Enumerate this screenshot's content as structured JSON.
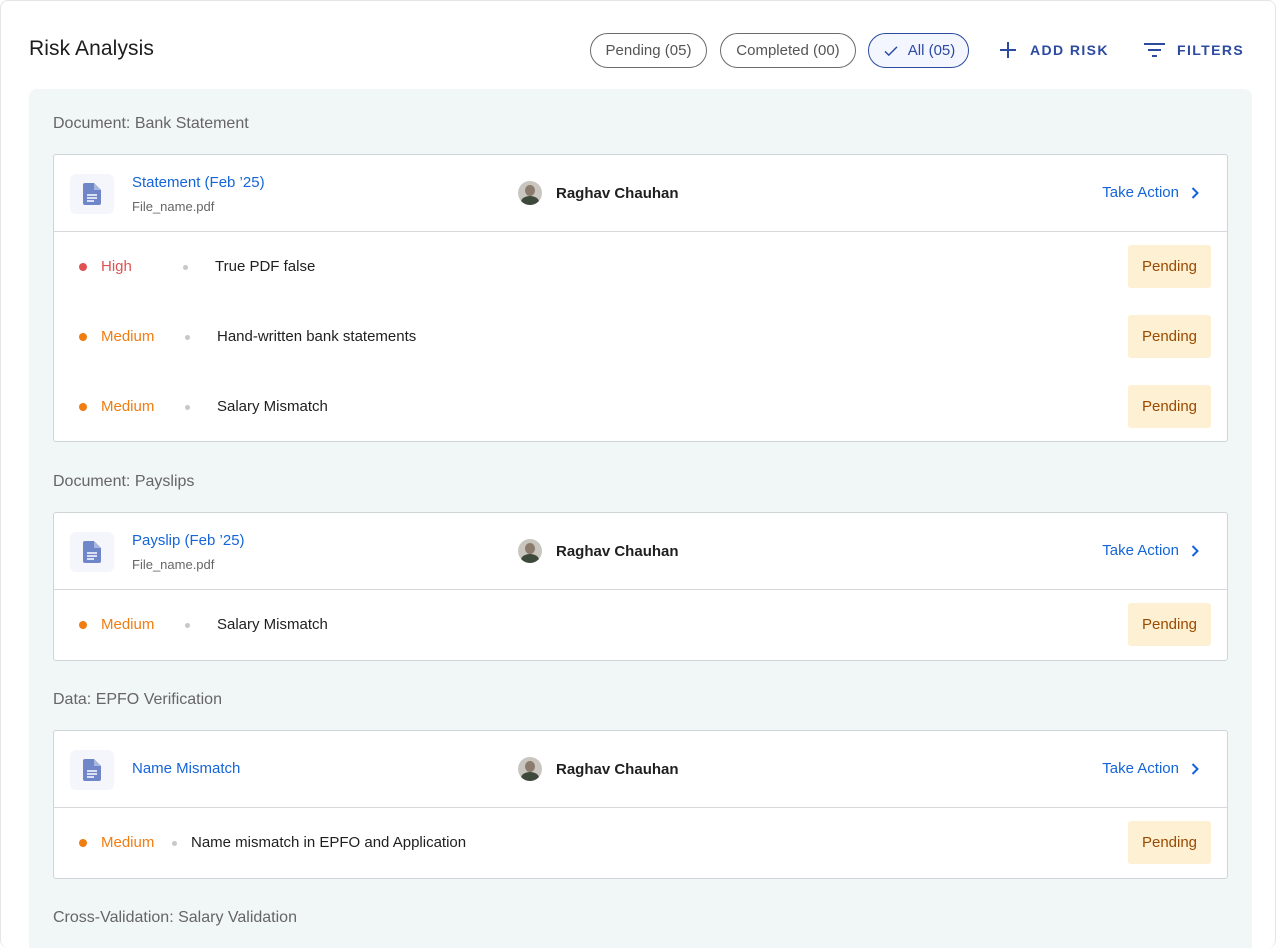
{
  "header": {
    "title": "Risk Analysis",
    "chips": [
      {
        "label": "Pending (05)"
      },
      {
        "label": "Completed (00)"
      },
      {
        "label": "All (05)"
      }
    ],
    "add_risk_label": "ADD RISK",
    "filters_label": "FILTERS"
  },
  "colors": {
    "accent": "#2b4aa0",
    "link": "#1565d8",
    "high": "#e05252",
    "medium": "#ef7d12",
    "badge_bg": "#fdf0d3",
    "badge_text": "#9a4a00"
  },
  "sections": [
    {
      "title": "Document: Bank Statement",
      "card": {
        "doc_title": "Statement (Feb ’25)",
        "file_name": "File_name.pdf",
        "owner": "Raghav Chauhan",
        "action": "Take Action",
        "risks": [
          {
            "severity": "High",
            "text": "True PDF false",
            "status": "Pending"
          },
          {
            "severity": "Medium",
            "text": "Hand-written bank statements",
            "status": "Pending"
          },
          {
            "severity": "Medium",
            "text": "Salary Mismatch",
            "status": "Pending"
          }
        ]
      }
    },
    {
      "title": "Document: Payslips",
      "card": {
        "doc_title": "Payslip (Feb ’25)",
        "file_name": "File_name.pdf",
        "owner": "Raghav Chauhan",
        "action": "Take Action",
        "risks": [
          {
            "severity": "Medium",
            "text": "Salary Mismatch",
            "status": "Pending"
          }
        ]
      }
    },
    {
      "title": "Data: EPFO Verification",
      "card": {
        "doc_title": "Name Mismatch",
        "owner": "Raghav Chauhan",
        "action": "Take Action",
        "risks": [
          {
            "severity": "Medium",
            "text": "Name mismatch in EPFO and Application",
            "status": "Pending"
          }
        ]
      }
    },
    {
      "title": "Cross-Validation: Salary Validation"
    }
  ]
}
